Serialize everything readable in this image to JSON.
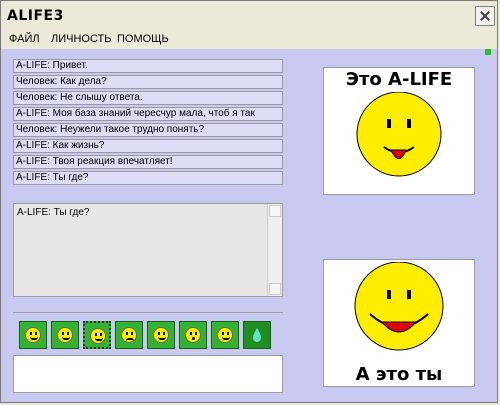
{
  "window": {
    "title": "ALIFE3"
  },
  "menu": [
    "ФАЙЛ",
    "ЛИЧНОСТЬ",
    "ПОМОЩЬ"
  ],
  "chat": [
    "A-LIFE:  Привет.",
    "Человек: Как дела?",
    "Человек: Не слышу ответа.",
    "A-LIFE:   Моя база знаний чересчур мала, чтоб я так",
    "Человек: Неужели такое трудно понять?",
    "A-LIFE:   Как жизнь?",
    "A-LIFE:   Твоя реакция впечатляет!",
    "A-LIFE:   Ты где?"
  ],
  "reply_text": "A-LIFE:  Ты где?",
  "images": {
    "top_caption": "Это A-LIFE",
    "bottom_caption": "А это ты"
  },
  "smileys": [
    "smile-icon",
    "smile-icon",
    "grin-icon",
    "sad-icon",
    "smirk-icon",
    "surprised-icon",
    "tongue-icon",
    "drop-icon"
  ],
  "colors": {
    "accent_green": "#33b233",
    "panel": "#c8c8f0"
  }
}
